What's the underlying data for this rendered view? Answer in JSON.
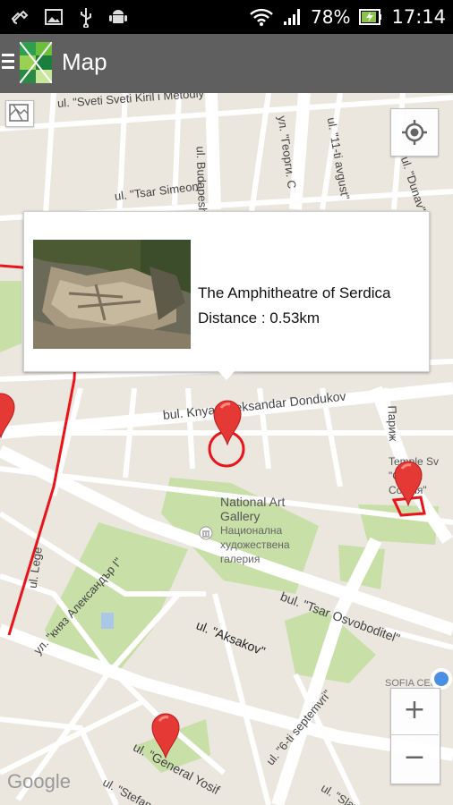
{
  "status_bar": {
    "battery": "78%",
    "time": "17:14"
  },
  "app_bar": {
    "title": "Map"
  },
  "map": {
    "street_labels": [
      "ul. \"Sveti Sveti Kiril i Metodiy\"",
      "ul. \"Tsar Simeon\"",
      "ul. Budapesht",
      "ул. \"Георги. С",
      "ul. \"11-ti avgust\"",
      "ul. \"Dunav\"",
      "bul. Knyaz Aleksandar Dondukov",
      "Париж",
      "ul. Lege",
      "ул. \"княз Александър I\"",
      "bul. \"Tsar Osvoboditel\"",
      "ul. \"Aksakov\"",
      "ul. \"6-ti septemvri\"",
      "ul. \"General Yosif",
      "ul. \"Stefan",
      "ul. \"Slav",
      "SOFIA CEN"
    ],
    "poi_gallery": {
      "name": "National Art Gallery",
      "name_bg": "Национална художествена галерия"
    },
    "poi_temple": {
      "name": "Temple Sv",
      "name_bg": "\"Света София\""
    },
    "attribution": "Google"
  },
  "popup": {
    "name": "The Amphitheatre of Serdica",
    "distance": "Distance : 0.53km"
  },
  "controls": {
    "zoom_in": "+",
    "zoom_out": "−"
  },
  "colors": {
    "route": "#e8141a",
    "marker": "#e53935",
    "park": "#c8dfa8",
    "road": "#ffffff"
  }
}
